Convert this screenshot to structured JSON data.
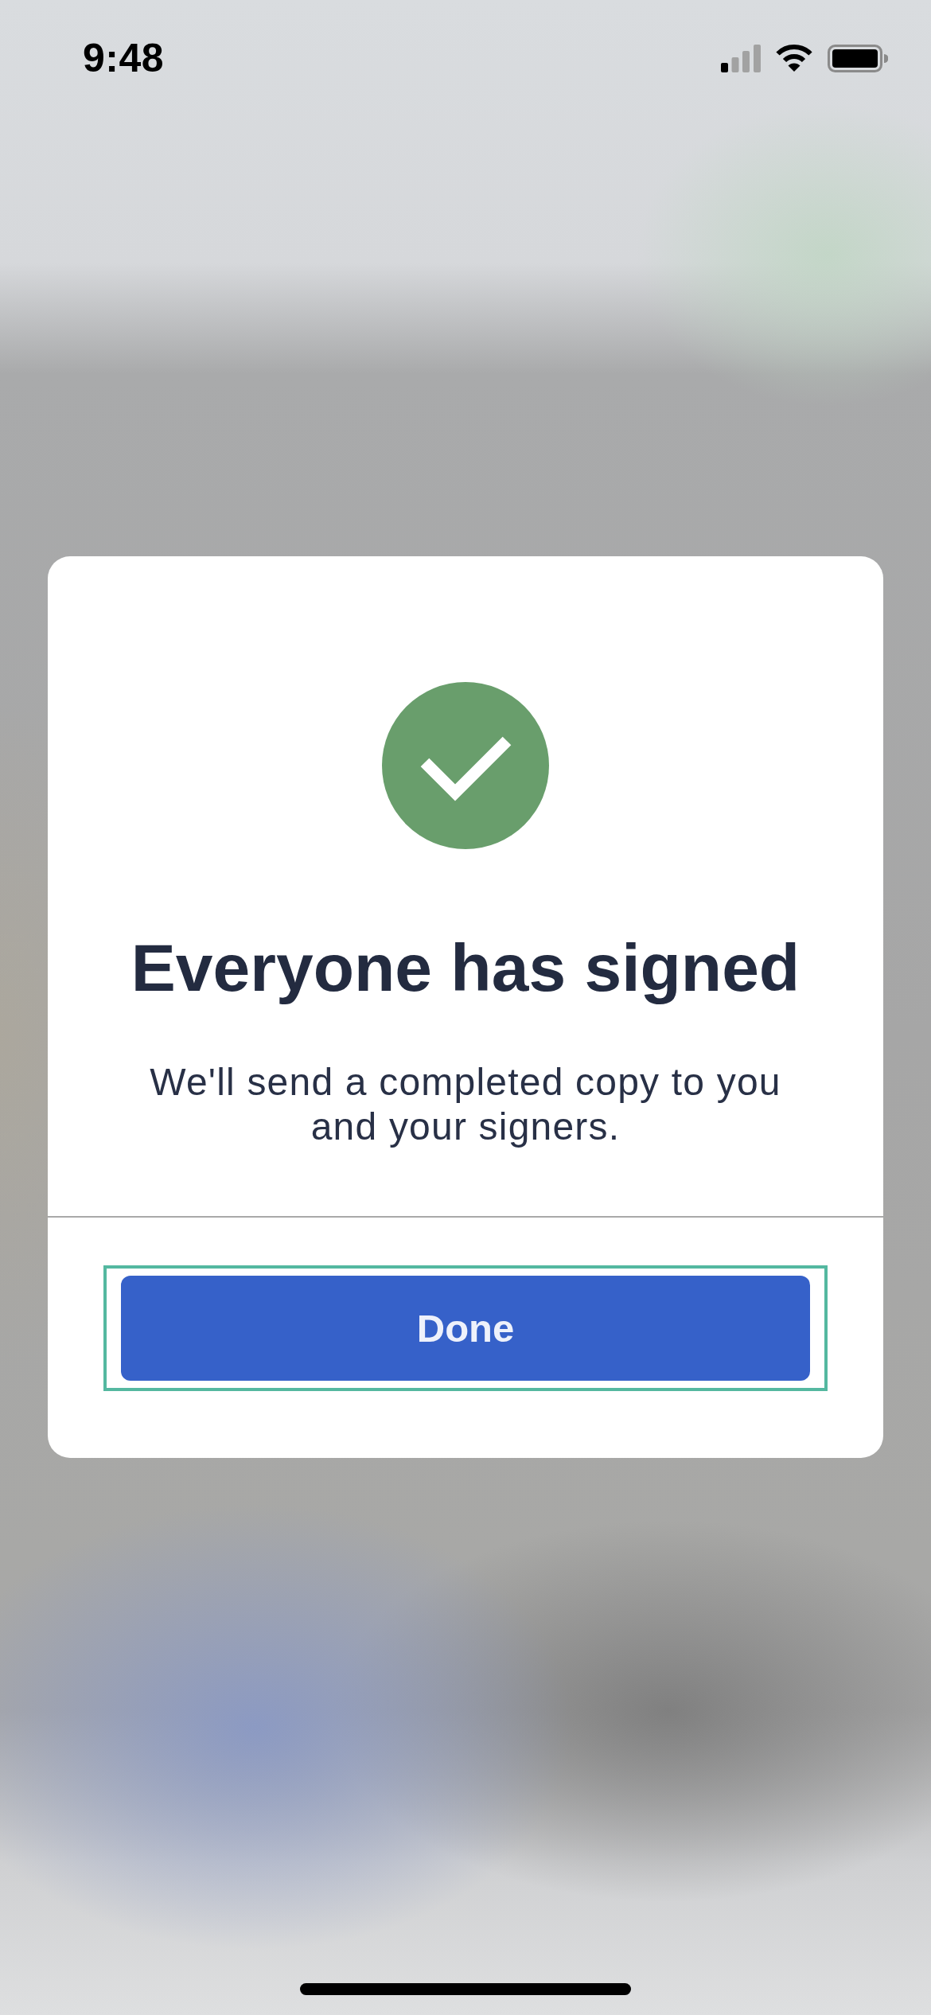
{
  "status_bar": {
    "time": "9:48"
  },
  "dialog": {
    "title": "Everyone has signed",
    "message": "We'll send a completed copy to you and your signers.",
    "button": {
      "label": "Done",
      "focused": true
    }
  }
}
